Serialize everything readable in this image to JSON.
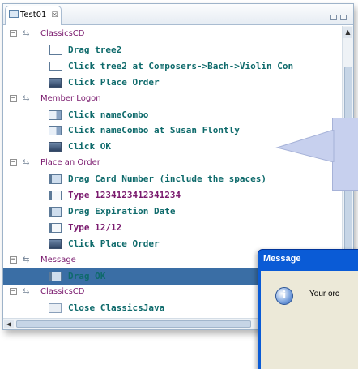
{
  "tab": {
    "title": "Test01",
    "close": "☒"
  },
  "tree": {
    "rows": [
      {
        "type": "group",
        "label": "ClassicsCD",
        "toggle": "⊟"
      },
      {
        "type": "step",
        "icon": "tree",
        "label": "Drag tree2",
        "color": "#0e6a6b"
      },
      {
        "type": "step",
        "icon": "tree",
        "label": "Click tree2 at Composers->Bach->Violin Con",
        "color": "#0e6a6b"
      },
      {
        "type": "step",
        "icon": "click",
        "label": "Click Place Order",
        "color": "#0e6a6b"
      },
      {
        "type": "group",
        "label": "Member Logon",
        "toggle": "⊟"
      },
      {
        "type": "step",
        "icon": "combo",
        "label": "Click nameCombo",
        "color": "#0e6a6b"
      },
      {
        "type": "step",
        "icon": "combo",
        "label": "Click nameCombo at Susan Flontly",
        "color": "#0e6a6b"
      },
      {
        "type": "step",
        "icon": "click",
        "label": "Click OK",
        "color": "#0e6a6b"
      },
      {
        "type": "group",
        "label": "Place an Order",
        "toggle": "⊟"
      },
      {
        "type": "step",
        "icon": "drag",
        "label": "Drag Card Number (include the spaces)",
        "color": "#0e6a6b"
      },
      {
        "type": "step",
        "icon": "type",
        "label": "Type 1234123412341234",
        "color": "#7a1a6e"
      },
      {
        "type": "step",
        "icon": "drag",
        "label": "Drag Expiration Date",
        "color": "#0e6a6b"
      },
      {
        "type": "step",
        "icon": "type",
        "label": "Type 12/12",
        "color": "#7a1a6e"
      },
      {
        "type": "step",
        "icon": "click",
        "label": "Click Place Order",
        "color": "#0e6a6b"
      },
      {
        "type": "group",
        "label": "Message",
        "toggle": "⊟"
      },
      {
        "type": "step",
        "icon": "drag",
        "label": "Drag OK",
        "color": "#0e6a6b",
        "selected": true
      },
      {
        "type": "group",
        "label": "ClassicsCD",
        "toggle": "⊟"
      },
      {
        "type": "step",
        "icon": "close",
        "label": "Close ClassicsJava",
        "color": "#0e6a6b"
      }
    ]
  },
  "dialog": {
    "title": "Message",
    "message": "Your orc"
  },
  "scroll": {
    "up": "▲",
    "left": "◀"
  }
}
